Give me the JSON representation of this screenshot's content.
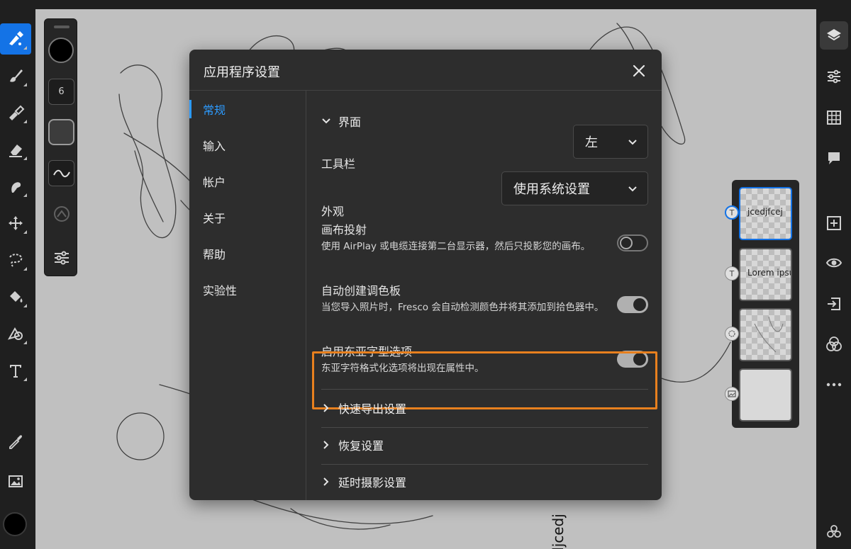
{
  "brush_panel": {
    "size_value": "6"
  },
  "canvas": {
    "vertical_text": "djcedj"
  },
  "layers": [
    {
      "thumb_text": "jcedjfcej",
      "badge": "T",
      "selected": true
    },
    {
      "thumb_text": "Lorem ipsum",
      "badge": "T",
      "selected": false
    },
    {
      "thumb_text": "",
      "badge": "sketch",
      "selected": false
    },
    {
      "thumb_text": "",
      "badge": "image",
      "selected": false
    }
  ],
  "dialog": {
    "title": "应用程序设置",
    "nav": [
      {
        "label": "常规",
        "active": true
      },
      {
        "label": "输入",
        "active": false
      },
      {
        "label": "帐户",
        "active": false
      },
      {
        "label": "关于",
        "active": false
      },
      {
        "label": "帮助",
        "active": false
      },
      {
        "label": "实验性",
        "active": false
      }
    ],
    "section_interface": "界面",
    "toolbar_label": "工具栏",
    "toolbar_value": "左",
    "appearance_label": "外观",
    "appearance_value": "使用系统设置",
    "canvas_projection": {
      "label": "画布投射",
      "desc": "使用 AirPlay 或电缆连接第二台显示器，然后只投影您的画布。",
      "enabled": false
    },
    "auto_palette": {
      "label": "自动创建调色板",
      "desc": "当您导入照片时，Fresco 会自动检测颜色并将其添加到拾色器中。",
      "enabled": true
    },
    "east_asian": {
      "label": "启用东亚字型选项",
      "desc": "东亚字符格式化选项将出现在属性中。",
      "enabled": true
    },
    "section_quick_export": "快速导出设置",
    "section_restore": "恢复设置",
    "section_timelapse": "延时摄影设置"
  },
  "colors": {
    "accent_blue": "#1473e6",
    "highlight_orange": "#e8801e",
    "active_nav": "#2d9bff"
  }
}
